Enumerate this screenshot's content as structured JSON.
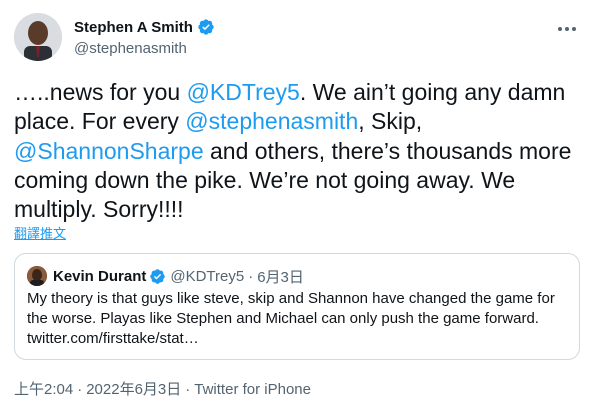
{
  "author": {
    "display_name": "Stephen A Smith",
    "handle": "@stephenasmith",
    "verified_icon": "verified-badge-icon"
  },
  "more_icon": "more-horizontal-icon",
  "tweet": {
    "segments": [
      {
        "text": "…..news for you ",
        "type": "text"
      },
      {
        "text": "@KDTrey5",
        "type": "mention"
      },
      {
        "text": ". We ain’t going any damn place. For every ",
        "type": "text"
      },
      {
        "text": "@stephenasmith",
        "type": "mention"
      },
      {
        "text": ", Skip, ",
        "type": "text"
      },
      {
        "text": "@ShannonSharpe",
        "type": "mention"
      },
      {
        "text": " and others, there’s thousands more coming down the pike. We’re not going away. We multiply. Sorry!!!!",
        "type": "text"
      }
    ],
    "translate_label": "翻譯推文"
  },
  "quoted_tweet": {
    "display_name": "Kevin Durant",
    "handle": "@KDTrey5",
    "separator": "·",
    "date": "6月3日",
    "text": "My theory is that guys like steve, skip and Shannon have changed the game for the worse. Playas like Stephen and Michael can only push the game forward. twitter.com/firsttake/stat…"
  },
  "meta": {
    "time": "上午2:04",
    "separator": "·",
    "date": "2022年6月3日",
    "source": "Twitter for iPhone"
  },
  "colors": {
    "link": "#1d9bf0",
    "text": "#0f1419",
    "secondary": "#536471",
    "border": "#cfd9de"
  }
}
